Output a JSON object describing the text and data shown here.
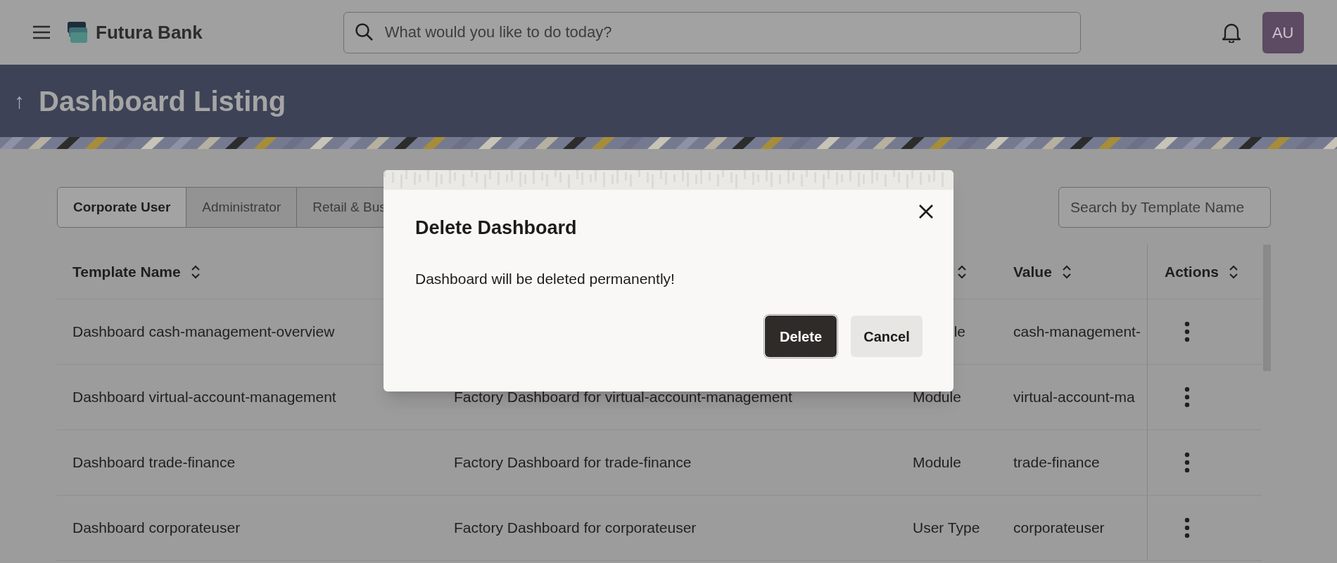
{
  "app": {
    "brand": "Futura Bank",
    "search_placeholder": "What would you like to do today?",
    "avatar": "AU"
  },
  "page": {
    "back_icon": "↑",
    "title": "Dashboard Listing"
  },
  "tabs": [
    {
      "label": "Corporate User",
      "selected": true
    },
    {
      "label": "Administrator",
      "selected": false
    },
    {
      "label": "Retail & Bus",
      "selected": false
    }
  ],
  "template_search": {
    "placeholder": "Search by Template Name"
  },
  "table": {
    "columns": [
      {
        "label": "Template Name",
        "sortable": true
      },
      {},
      {
        "sortable": true
      },
      {
        "label": "Value",
        "sortable": true
      },
      {
        "label": "Actions",
        "sortable": true
      }
    ],
    "rows": [
      {
        "cells": [
          {
            "text": "Dashboard cash-management-overview"
          },
          {},
          {
            "text": "le",
            "clipped_start": true
          },
          {
            "text": "cash-management-"
          }
        ]
      },
      {
        "cells": [
          {
            "text": "Dashboard virtual-account-management"
          },
          {
            "text": "Factory Dashboard for virtual-account-management"
          },
          {
            "text": "Module"
          },
          {
            "text": "virtual-account-ma"
          }
        ]
      },
      {
        "cells": [
          {
            "text": "Dashboard trade-finance"
          },
          {
            "text": "Factory Dashboard for trade-finance"
          },
          {
            "text": "Module"
          },
          {
            "text": "trade-finance"
          }
        ]
      },
      {
        "cells": [
          {
            "text": "Dashboard corporateuser"
          },
          {
            "text": "Factory Dashboard for corporateuser"
          },
          {
            "text": "User Type"
          },
          {
            "text": "corporateuser"
          }
        ]
      }
    ]
  },
  "dialog": {
    "title": "Delete Dashboard",
    "message": "Dashboard will be deleted permanently!",
    "buttons": [
      {
        "label": "Delete",
        "kind": "primary"
      },
      {
        "label": "Cancel",
        "kind": "secondary"
      }
    ]
  }
}
